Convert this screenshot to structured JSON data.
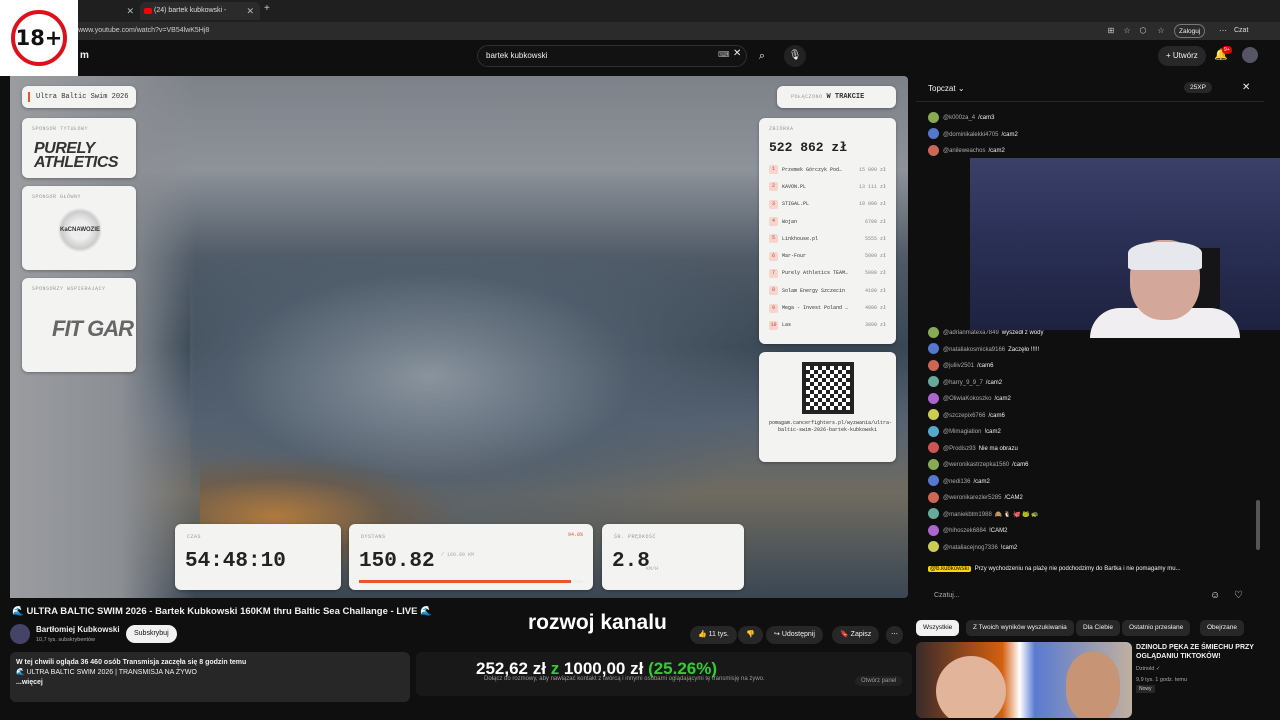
{
  "browser": {
    "tab1_title": "",
    "tab2_title": "(24) bartek kubkowski - YouTube",
    "url": "www.youtube.com/watch?v=VB54lwK5Hj8",
    "login": "Zaloguj",
    "chat_ai": "Czat"
  },
  "age_badge": "18+",
  "header": {
    "logo_fragment": "m",
    "search_value": "bartek kubkowski",
    "create_label": "Utwórz",
    "notifications": "9+"
  },
  "overlay": {
    "title": "Ultra Baltic Swim 2026",
    "sponsor_title_label": "SPONSOR TYTUŁOWY",
    "sponsor_title_logo": "PURELY ATHLETICS",
    "sponsor_main_label": "SPONSOR GŁÓWNY",
    "sponsor_main_logo": "KaCNAWOZIE",
    "sponsor_support_label": "SPONSORZY WSPIERAJĄCY",
    "sponsor_support_logo": "FIT GAR",
    "status_label": "POŁĄCZONO",
    "status_value": "W TRAKCIE",
    "donations_label": "ZBIÓRKA",
    "donations_total": "522 862 zł",
    "donors": [
      {
        "n": "1",
        "name": "Przemek Górczyk Pod…",
        "v": "15 000 zł"
      },
      {
        "n": "2",
        "name": "KAVON.PL",
        "v": "13 111 zł"
      },
      {
        "n": "3",
        "name": "STIGAL.PL",
        "v": "10 000 zł"
      },
      {
        "n": "4",
        "name": "Wojan",
        "v": "6700 zł"
      },
      {
        "n": "5",
        "name": "Linkhouse.pl",
        "v": "5555 zł"
      },
      {
        "n": "6",
        "name": "Mar-Four",
        "v": "5000 zł"
      },
      {
        "n": "7",
        "name": "Purely Athletics TEAM…",
        "v": "5000 zł"
      },
      {
        "n": "8",
        "name": "Solam Energy Szczecin",
        "v": "4100 zł"
      },
      {
        "n": "9",
        "name": "Mega - Invest Poland …",
        "v": "4000 zł"
      },
      {
        "n": "10",
        "name": "Las",
        "v": "3800 zł"
      }
    ],
    "qr_url": "pomagam.cancerfighters.pl/wyzwania/ultra-baltic-swim-2026-bartek-kubkowski",
    "time_label": "CZAS",
    "time_value": "54:48:10",
    "distance_label": "DYSTANS",
    "distance_value": "150.82",
    "distance_total": "/ 160.00 KM",
    "distance_pct": "94.8%",
    "distance_progress": 0.948,
    "speed_label": "ŚR. PRĘDKOŚĆ",
    "speed_value": "2.8",
    "speed_unit": "KM/H"
  },
  "chat": {
    "title": "Topczat",
    "xp": "25XP",
    "input_placeholder": "Czatuj...",
    "messages": [
      {
        "u": "@adrianmatexa7849",
        "t": "wyszedł z wody"
      },
      {
        "u": "@nataliakosmicka9166",
        "t": "Zaczęło !!!!!"
      },
      {
        "u": "@juliiv2501",
        "t": "/cam6"
      },
      {
        "u": "@harry_9_9_7",
        "t": "/cam2"
      },
      {
        "u": "@OliwiaKokoszko",
        "t": "/cam2"
      },
      {
        "u": "@szczepix6766",
        "t": "/cam6"
      },
      {
        "u": "@Mimagiation",
        "t": "!cam2"
      },
      {
        "u": "@Prodisz93",
        "t": "Nie ma obrazu"
      },
      {
        "u": "@weronikastrzepka1560",
        "t": "/cam6"
      },
      {
        "u": "@nedi136",
        "t": "/cam2"
      },
      {
        "u": "@weronikarezler5285",
        "t": "/CAM2"
      },
      {
        "u": "@maniekbtm1988",
        "t": "🙈 🐧 🐙 🐸 🐢"
      },
      {
        "u": "@hihoszek6884",
        "t": "!CAM2"
      },
      {
        "u": "@nataliacejnog7336",
        "t": "!cam2"
      }
    ],
    "top_messages": [
      {
        "u": "@k000za_4",
        "t": "/cam3"
      },
      {
        "u": "@dominikalekki4705",
        "t": "/cam2"
      },
      {
        "u": "@anileweachos",
        "t": "/cam2"
      }
    ],
    "pinned_user": "@b.kubkowski",
    "pinned_text": "Przy wychodzeniu na plażę nie podchodzimy do Bartka i nie pomagamy mu..."
  },
  "video": {
    "title": "🌊 ULTRA BALTIC SWIM 2026 - Bartek Kubkowski 160KM thru Baltic Sea Challange - LIVE 🌊",
    "channel": "Bartłomiej Kubkowski",
    "subs": "10,7 tys. subskrybentów",
    "subscribe": "Subskrybuj",
    "likes": "11 tys.",
    "share": "Udostępnij",
    "save": "Zapisz",
    "desc_line1": "W tej chwili ogląda 36 460 osób  Transmisja zaczęła się 8 godzin temu",
    "desc_line2": "🌊 ULTRA BALTIC SWIM 2026 | TRANSMISJA NA ŻYWO",
    "desc_more": "...więcej",
    "overlay_text": "rozwoj kanalu",
    "goal_current": "252,62 zł",
    "goal_z": "z",
    "goal_target": "1000,00 zł",
    "goal_pct": "(25.26%)",
    "comment_hint": "Dołącz do rozmowy, aby nawiązać kontakt z twórcą i innymi osobami oglądającymi tę transmisję na żywo.",
    "comment_btn": "Otwórz panel"
  },
  "chips": [
    "Wszystkie",
    "Z Twoich wyników wyszukiwania",
    "Dla Ciebie",
    "Ostatnio przesłane",
    "Obejrzane"
  ],
  "rec": {
    "title": "DZINOLD PĘKA ZE ŚMIECHU PRZY OGLĄDANIU TIKTOKÓW!",
    "channel": "Dzinold ✓",
    "meta": "9,9 tys.  1 godz. temu",
    "new": "Nowy"
  }
}
